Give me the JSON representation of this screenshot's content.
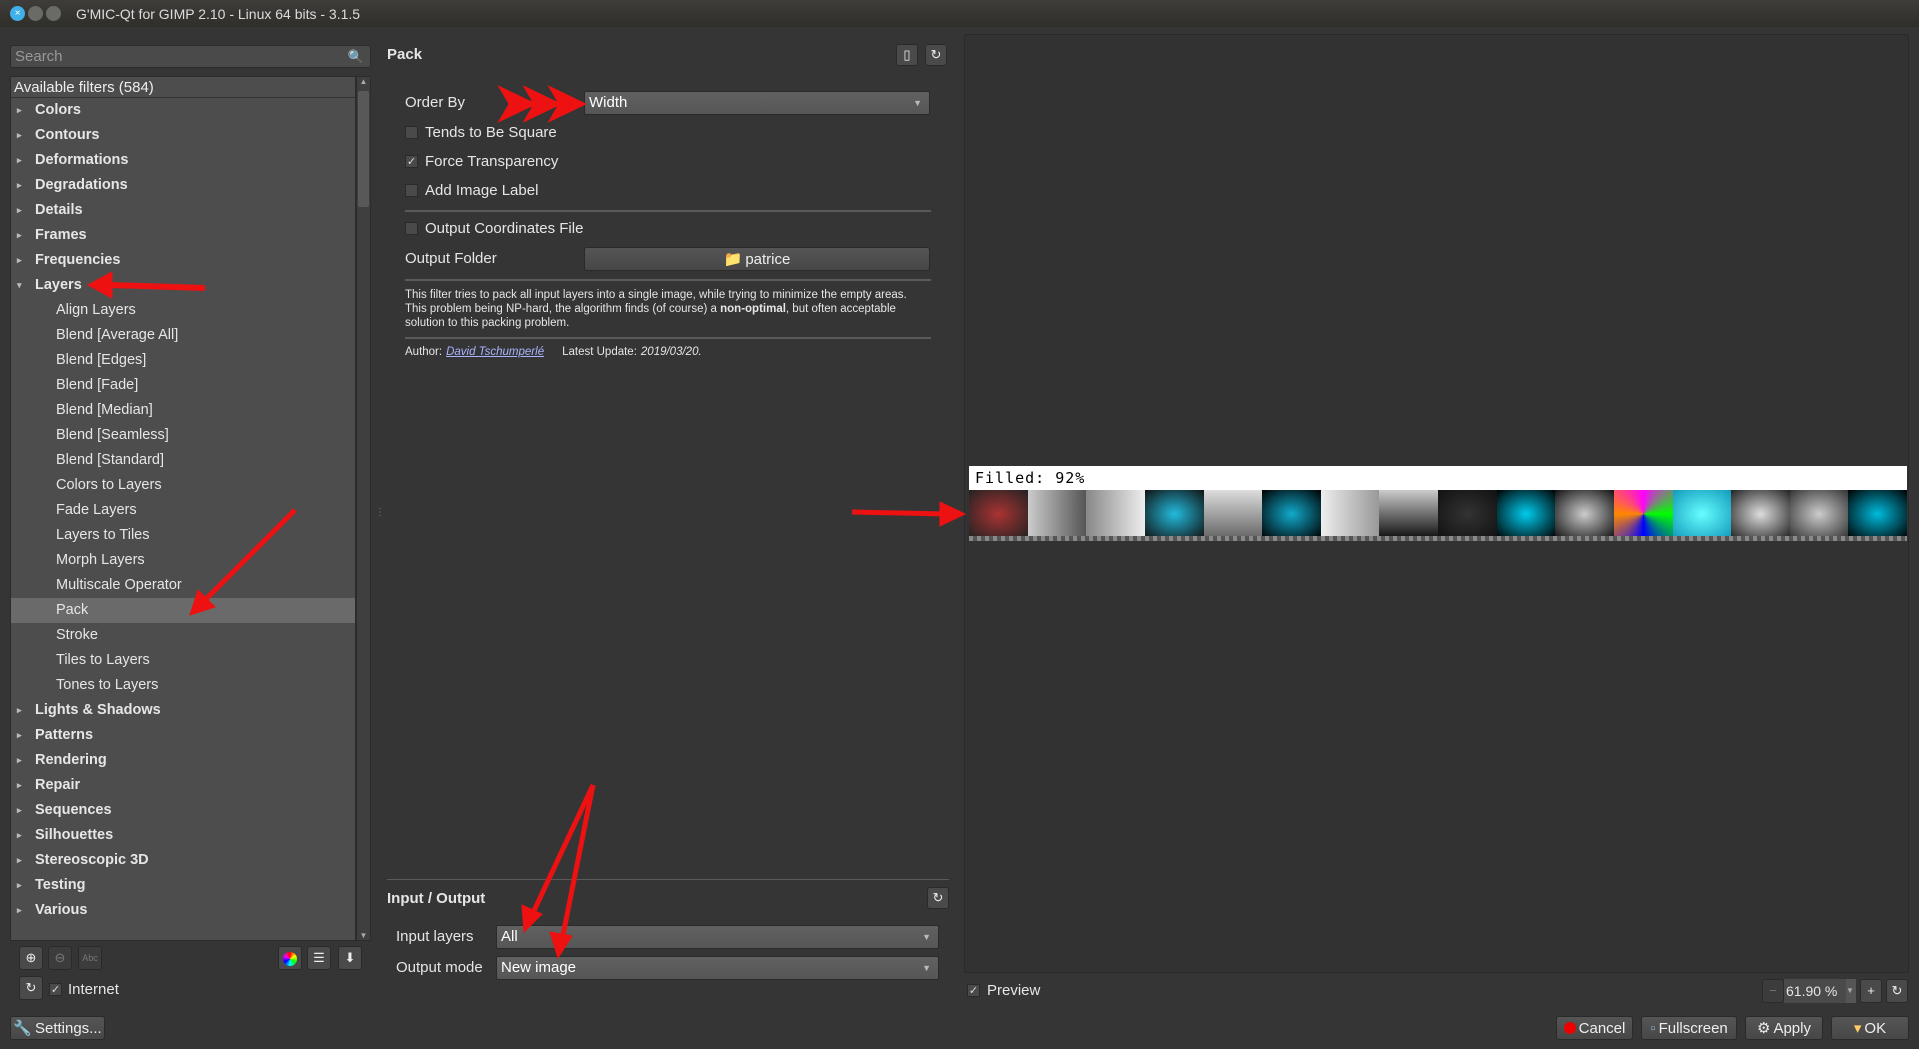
{
  "window": {
    "title": "G'MIC-Qt for GIMP 2.10 - Linux 64 bits - 3.1.5"
  },
  "search": {
    "placeholder": "Search"
  },
  "filters": {
    "header": "Available filters (584)",
    "categories_before": [
      "Colors",
      "Contours",
      "Deformations",
      "Degradations",
      "Details",
      "Frames",
      "Frequencies"
    ],
    "open_category": "Layers",
    "layers_items": [
      "Align Layers",
      "Blend [Average All]",
      "Blend [Edges]",
      "Blend [Fade]",
      "Blend [Median]",
      "Blend [Seamless]",
      "Blend [Standard]",
      "Colors to Layers",
      "Fade Layers",
      "Layers to Tiles",
      "Morph Layers",
      "Multiscale Operator",
      "Pack",
      "Stroke",
      "Tiles to Layers",
      "Tones to Layers"
    ],
    "selected": "Pack",
    "categories_after": [
      "Lights & Shadows",
      "Patterns",
      "Rendering",
      "Repair",
      "Sequences",
      "Silhouettes",
      "Stereoscopic 3D",
      "Testing",
      "Various"
    ]
  },
  "left_bottom": {
    "internet_label": "Internet",
    "internet_checked": true,
    "settings_label": "Settings..."
  },
  "filter": {
    "name": "Pack",
    "order_by_label": "Order By",
    "order_by_value": "Width",
    "tends_square": "Tends to Be Square",
    "tends_square_checked": false,
    "force_transparency": "Force Transparency",
    "force_transparency_checked": true,
    "add_label": "Add Image Label",
    "add_label_checked": false,
    "output_coords": "Output Coordinates File",
    "output_coords_checked": false,
    "output_folder_label": "Output Folder",
    "output_folder_value": "patrice",
    "desc_1": "This filter tries to pack all input layers into a single image, while trying to minimize the empty areas. This problem being NP-hard, the algorithm finds (of course) a ",
    "desc_bold": "non-optimal",
    "desc_2": ", but often acceptable solution to this packing problem.",
    "author_label": "Author:",
    "author": "David Tschumperlé",
    "update_label": "Latest Update:",
    "update": "2019/03/20."
  },
  "io": {
    "title": "Input / Output",
    "input_label": "Input layers",
    "input_value": "All",
    "output_label": "Output mode",
    "output_value": "New image"
  },
  "preview": {
    "filled_text": "Filled:  92%",
    "preview_label": "Preview",
    "preview_checked": true,
    "zoom": "61.90 %"
  },
  "buttons": {
    "cancel": "Cancel",
    "fullscreen": "Fullscreen",
    "apply": "Apply",
    "ok": "OK"
  },
  "colors": {
    "annotation": "#ee1111",
    "bg": "#353535"
  }
}
